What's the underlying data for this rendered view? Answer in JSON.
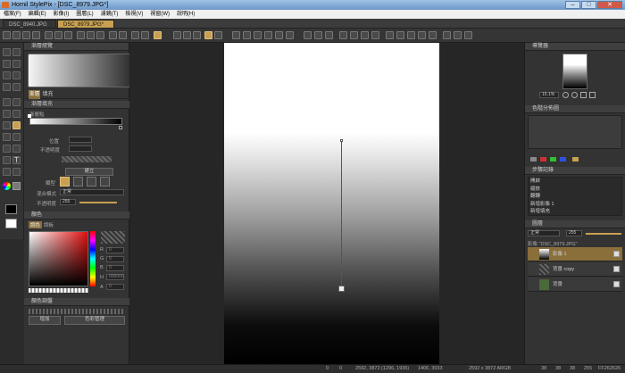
{
  "window": {
    "title": "Hornil StylePix - [DSC_8979.JPG*]",
    "minimize": "–",
    "maximize": "□",
    "close": "✕"
  },
  "menu": [
    "檔案(F)",
    "編輯(E)",
    "影像(I)",
    "圖層(L)",
    "濾鏡(T)",
    "檢視(V)",
    "視窗(W)",
    "說明(H)"
  ],
  "tabs": [
    {
      "label": "DSC_8940.JPG"
    },
    {
      "label": "DSC_8979.JPG*"
    }
  ],
  "left": {
    "preview_title": "漸層總覽",
    "tab_gradient": "漸層",
    "tab_fill": "填充",
    "fill_section": "漸層填充",
    "gradient_label": "漸層點",
    "position_label": "位置",
    "opacity_label": "不透明度",
    "position_value": "",
    "opacity_value": "",
    "create_button": "建立",
    "type_label": "類型",
    "blend_label": "混合模式",
    "blend_value": "正常",
    "alpha_label": "不透明度",
    "alpha_value": "255",
    "color_title": "顏色",
    "color_tab_palette": "調色",
    "color_tab_mix": "調板",
    "swatch_title": "顏色調盤",
    "swatch_add": "增加",
    "swatch_manage": "色彩管理",
    "rgb_labels": [
      "R",
      "G",
      "B",
      "H",
      "A"
    ],
    "rgb_values": [
      "0",
      "0",
      "0",
      "000000",
      "0"
    ]
  },
  "right": {
    "navigator_title": "導覽器",
    "zoom": "15.1%",
    "histogram_title": "色階分佈圖",
    "history_title": "步驟記錄",
    "history": [
      "開啟",
      "縮放",
      "翻轉",
      "新增影像 1",
      "新增填充"
    ],
    "layers_title": "圖層",
    "blend_mode": "正常",
    "opacity": "255",
    "image_name": "影像 \"DSC_8979.JPG\"",
    "layers": [
      "影像 1",
      "背景 copy",
      "背景"
    ]
  },
  "status": {
    "pos1": "0",
    "pos2": "0",
    "coords": "2592, 3872  (1296, 1936)",
    "cursor": "1406, 3033",
    "size": "2592 x 3872 ARGB",
    "v1": "38",
    "v2": "38",
    "v3": "38",
    "v4": "255",
    "hex": "FF262626"
  }
}
